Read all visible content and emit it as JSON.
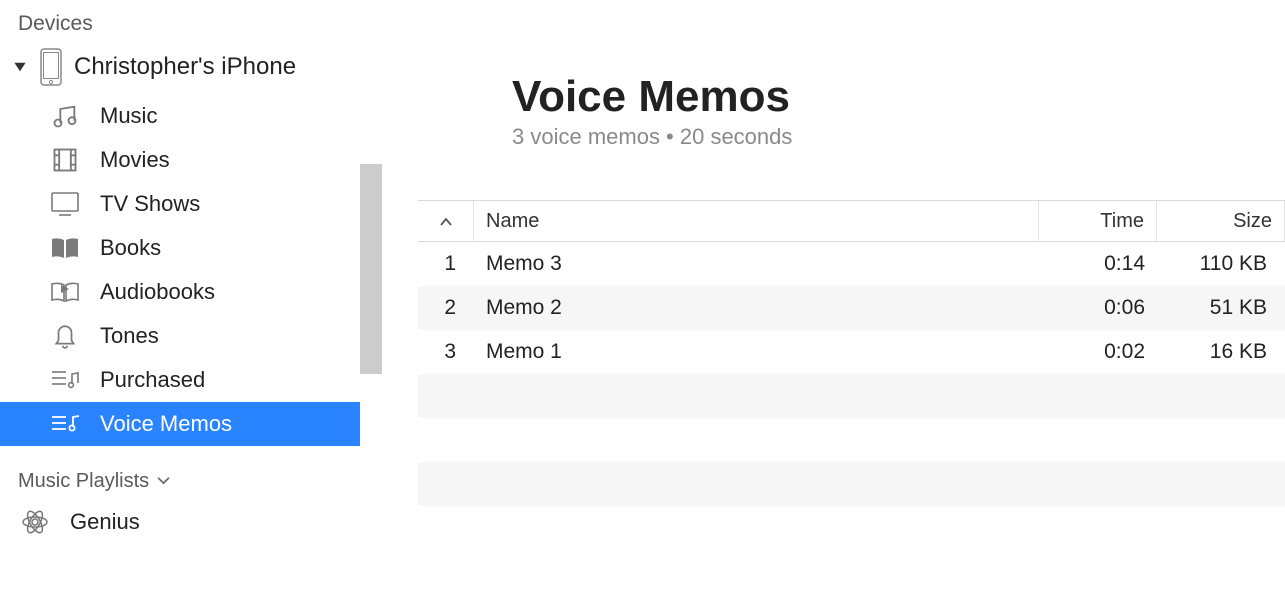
{
  "sidebar": {
    "sections": {
      "devices_label": "Devices",
      "playlists_label": "Music Playlists"
    },
    "device_name": "Christopher's iPhone",
    "items": [
      {
        "label": "Music"
      },
      {
        "label": "Movies"
      },
      {
        "label": "TV Shows"
      },
      {
        "label": "Books"
      },
      {
        "label": "Audiobooks"
      },
      {
        "label": "Tones"
      },
      {
        "label": "Purchased"
      },
      {
        "label": "Voice Memos"
      }
    ],
    "genius_label": "Genius"
  },
  "main": {
    "title": "Voice Memos",
    "subtitle": "3 voice memos • 20 seconds",
    "columns": {
      "name": "Name",
      "time": "Time",
      "size": "Size"
    },
    "rows": [
      {
        "num": "1",
        "name": "Memo 3",
        "time": "0:14",
        "size": "110 KB"
      },
      {
        "num": "2",
        "name": "Memo 2",
        "time": "0:06",
        "size": "51 KB"
      },
      {
        "num": "3",
        "name": "Memo 1",
        "time": "0:02",
        "size": "16 KB"
      }
    ]
  }
}
